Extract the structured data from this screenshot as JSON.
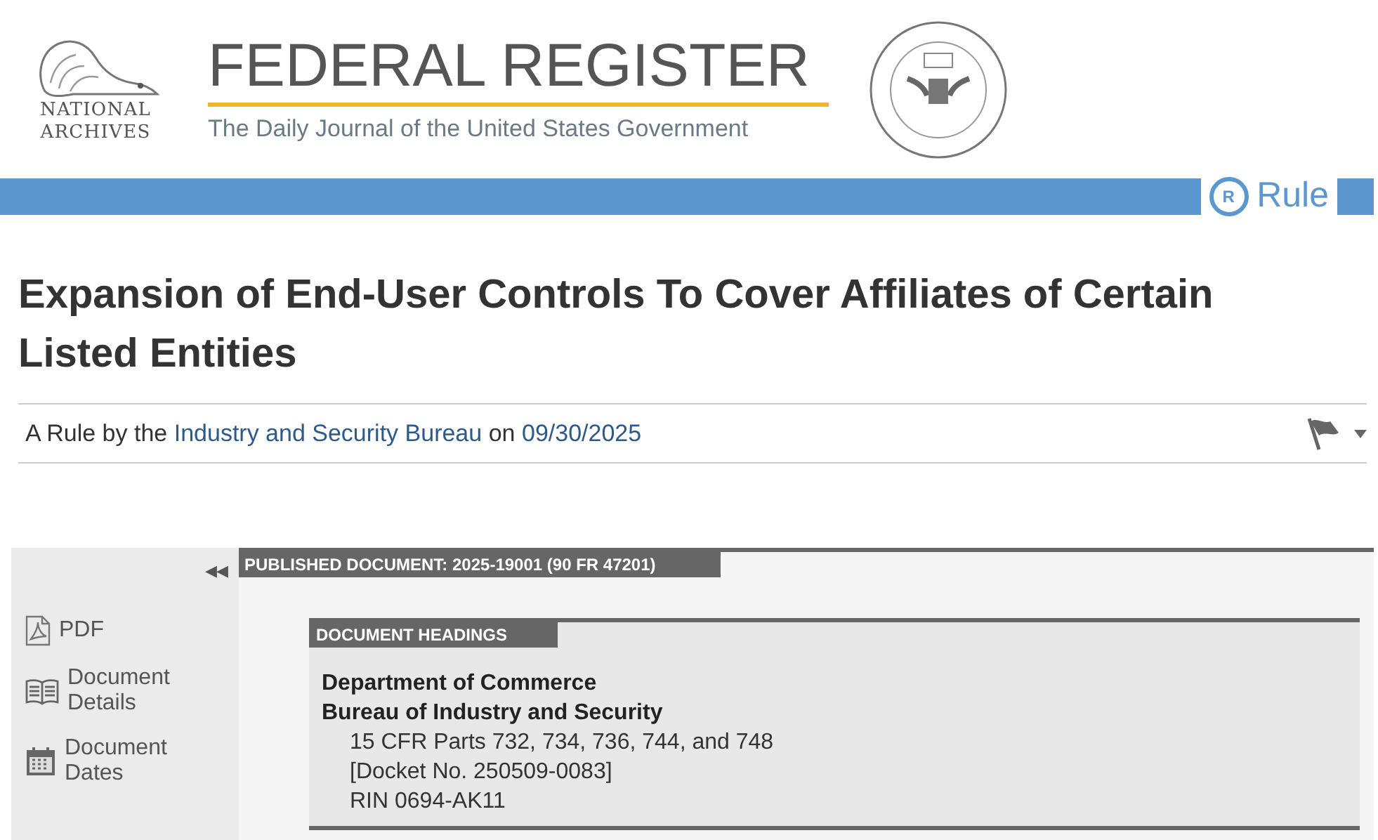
{
  "header": {
    "agency_lines": [
      "NATIONAL",
      "ARCHIVES"
    ],
    "title": "FEDERAL REGISTER",
    "tagline": "The Daily Journal of the United States Government"
  },
  "document_type": {
    "letter": "R",
    "label": "Rule"
  },
  "title": "Expansion of End-User Controls To Cover Affiliates of Certain Listed Entities",
  "byline": {
    "prefix": "A Rule by the",
    "agency": "Industry and Security Bureau",
    "middle": "on",
    "date": "09/30/2025"
  },
  "sidebar": {
    "collapse": "◀◀",
    "items": [
      {
        "kind": "pdf",
        "label": "PDF"
      },
      {
        "kind": "details",
        "label": "Document Details"
      },
      {
        "kind": "dates",
        "label": "Document Dates"
      }
    ]
  },
  "published_label": "PUBLISHED DOCUMENT: 2025-19001 (90 FR 47201)",
  "headings": {
    "label": "DOCUMENT HEADINGS",
    "lines": [
      {
        "kind": "agency",
        "text": "Department of Commerce"
      },
      {
        "kind": "agency",
        "text": "Bureau of Industry and Security"
      },
      {
        "kind": "detail",
        "text": "15 CFR Parts 732, 734, 736, 744, and 748"
      },
      {
        "kind": "detail",
        "text": "[Docket No. 250509-0083]"
      },
      {
        "kind": "detail",
        "text": "RIN 0694-AK11"
      }
    ]
  }
}
